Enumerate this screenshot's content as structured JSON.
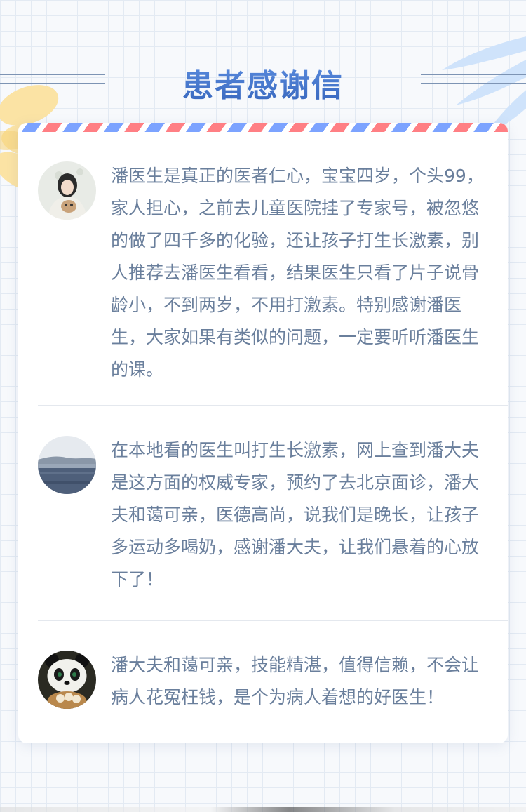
{
  "header": {
    "title": "患者感谢信"
  },
  "colors": {
    "title": "#3f6fc4",
    "body_text": "#6a7f9c",
    "stripe_red": "#ff7f84",
    "stripe_blue": "#7ca3ff"
  },
  "reviews": [
    {
      "avatar_icon": "woman-with-cat-avatar",
      "text": "潘医生是真正的医者仁心，宝宝四岁，个头99，家人担心，之前去儿童医院挂了专家号，被忽悠的做了四千多的化验，还让孩子打生长激素，别人推荐去潘医生看看，结果医生只看了片子说骨龄小，不到两岁，不用打激素。特别感谢潘医生，大家如果有类似的问题，一定要听听潘医生的课。"
    },
    {
      "avatar_icon": "lake-landscape-avatar",
      "text": "在本地看的医生叫打生长激素，网上查到潘大夫是这方面的权威专家，预约了去北京面诊，潘大夫和蔼可亲，医德高尚，说我们是晚长，让孩子多运动多喝奶，感谢潘大夫，让我们悬着的心放下了！"
    },
    {
      "avatar_icon": "panda-avatar",
      "text": "潘大夫和蔼可亲，技能精湛，值得信赖，不会让病人花冤枉钱，是个为病人着想的好医生！"
    }
  ]
}
